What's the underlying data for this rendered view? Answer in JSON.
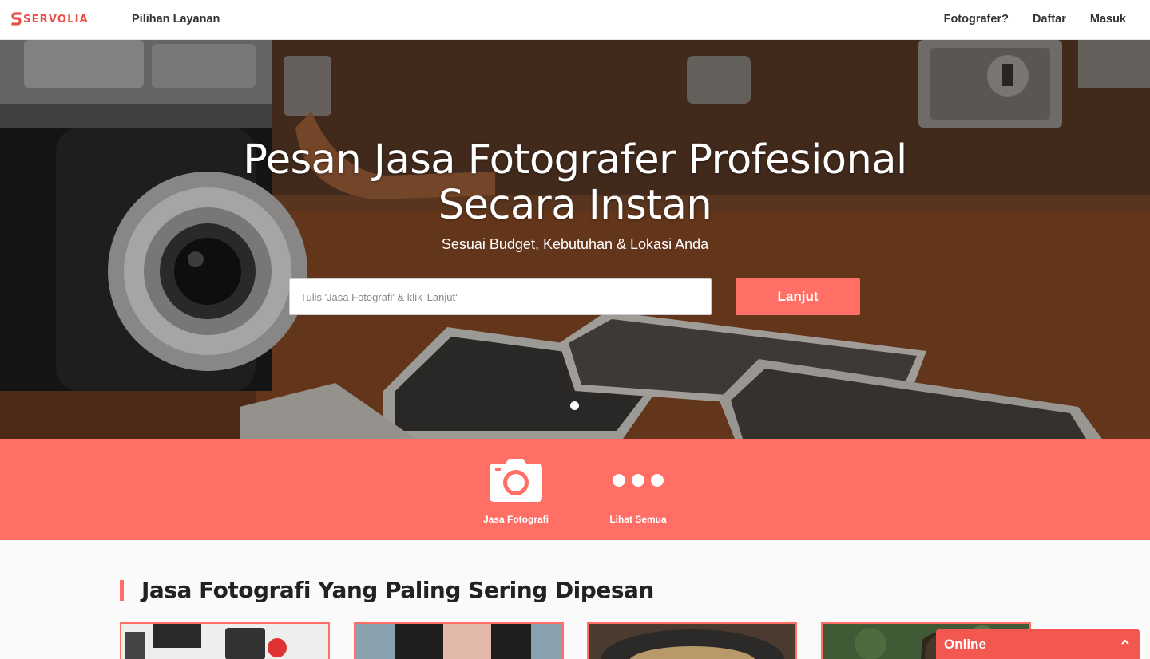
{
  "brand": {
    "name": "SERVOLIA",
    "color": "#e8514a"
  },
  "nav": {
    "services_label": "Pilihan Layanan",
    "photographer_label": "Fotografer?",
    "register_label": "Daftar",
    "login_label": "Masuk"
  },
  "hero": {
    "title_line1": "Pesan Jasa Fotografer Profesional",
    "title_line2": "Secara Instan",
    "subtitle": "Sesuai Budget, Kebutuhan & Lokasi Anda",
    "search_placeholder": "Tulis 'Jasa Fotografi' & klik 'Lanjut'",
    "cta_label": "Lanjut",
    "slide_count": 1,
    "active_slide": 1
  },
  "categories": [
    {
      "label": "Jasa Fotografi",
      "icon": "camera-icon"
    },
    {
      "label": "Lihat Semua",
      "icon": "more-dots-icon"
    }
  ],
  "section": {
    "title_bold": "Jasa Fotografi",
    "title_rest": " Yang Paling Sering Dipesan"
  },
  "cards": [
    {
      "image": "desk-flatlay-photo"
    },
    {
      "image": "portrait-leather-jacket-photo"
    },
    {
      "image": "food-plate-photo"
    },
    {
      "image": "portrait-woman-photo"
    }
  ],
  "chat": {
    "label": "Online",
    "icon": "chevron-up-icon"
  },
  "colors": {
    "accent": "#ff6f65",
    "chat": "#f2584f"
  }
}
